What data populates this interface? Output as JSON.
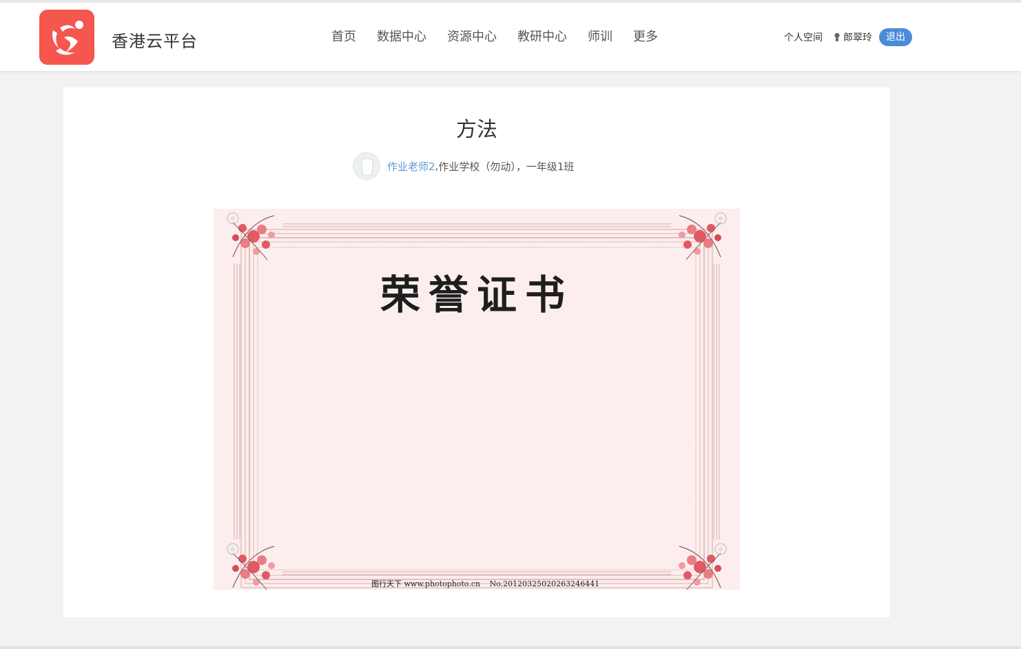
{
  "site": {
    "title": "香港云平台"
  },
  "nav": {
    "items": [
      "首页",
      "数据中心",
      "资源中心",
      "教研中心",
      "师训",
      "更多"
    ]
  },
  "user": {
    "space_label": "个人空间",
    "name": "郎翠玲",
    "logout_label": "退出",
    "icon": "user-icon"
  },
  "article": {
    "title": "方法",
    "author": "作业老师2",
    "separator": ",",
    "school": " 作业学校（勿动），一年级1班",
    "image": {
      "heading": "荣誉证书",
      "footer_source": "图行天下 www.photophoto.cn",
      "footer_no": "No.20120325020263246441"
    }
  },
  "colors": {
    "brand": "#f5564e",
    "link": "#5b9bd5",
    "logout": "#4a8cd9",
    "certificate_bg": "#fbeeed",
    "flower": "#e05a63"
  }
}
